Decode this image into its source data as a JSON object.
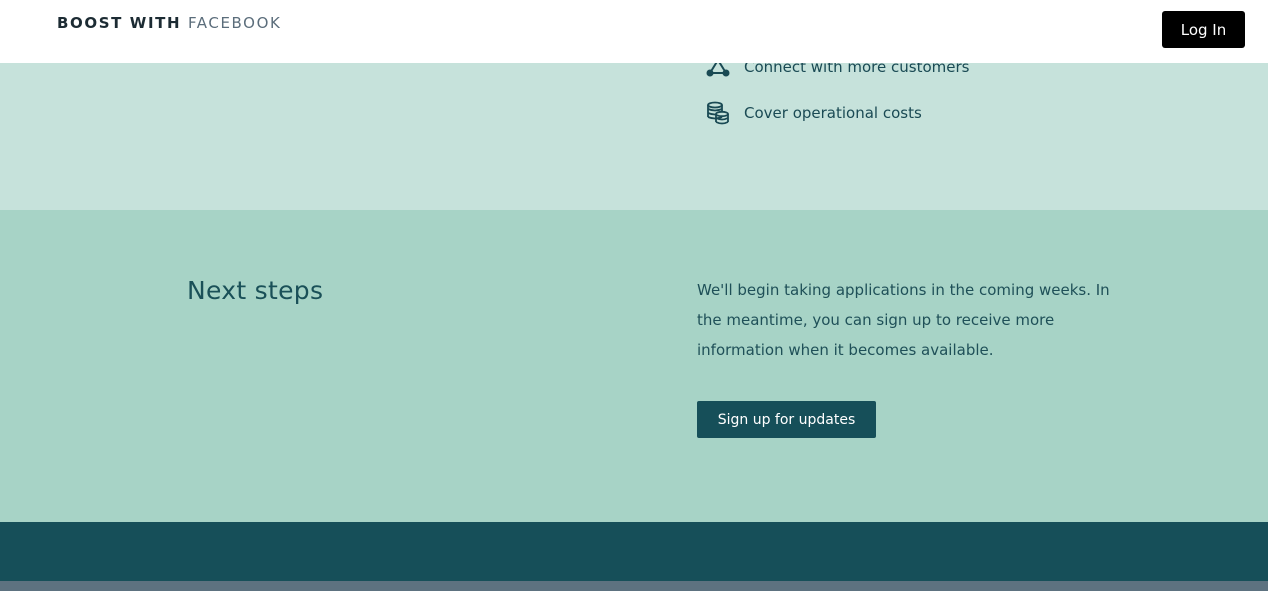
{
  "header": {
    "brand_part1": "BOOST WITH",
    "brand_part2": "FACEBOOK",
    "login_label": "Log In"
  },
  "benefits": {
    "items": [
      {
        "icon": "network-icon",
        "label": "Connect with more customers"
      },
      {
        "icon": "coins-stack-icon",
        "label": "Cover operational costs"
      }
    ]
  },
  "next_steps": {
    "title": "Next steps",
    "body": "We'll begin taking applications in the coming weeks. In the meantime, you can sign up to receive more information when it becomes available.",
    "button_label": "Sign up for updates"
  },
  "colors": {
    "header_bg": "#ffffff",
    "benefits_bg": "#c6e2db",
    "next_steps_bg": "#a7d3c6",
    "primary_dark": "#164f59",
    "footer_strip": "#5d7280"
  }
}
